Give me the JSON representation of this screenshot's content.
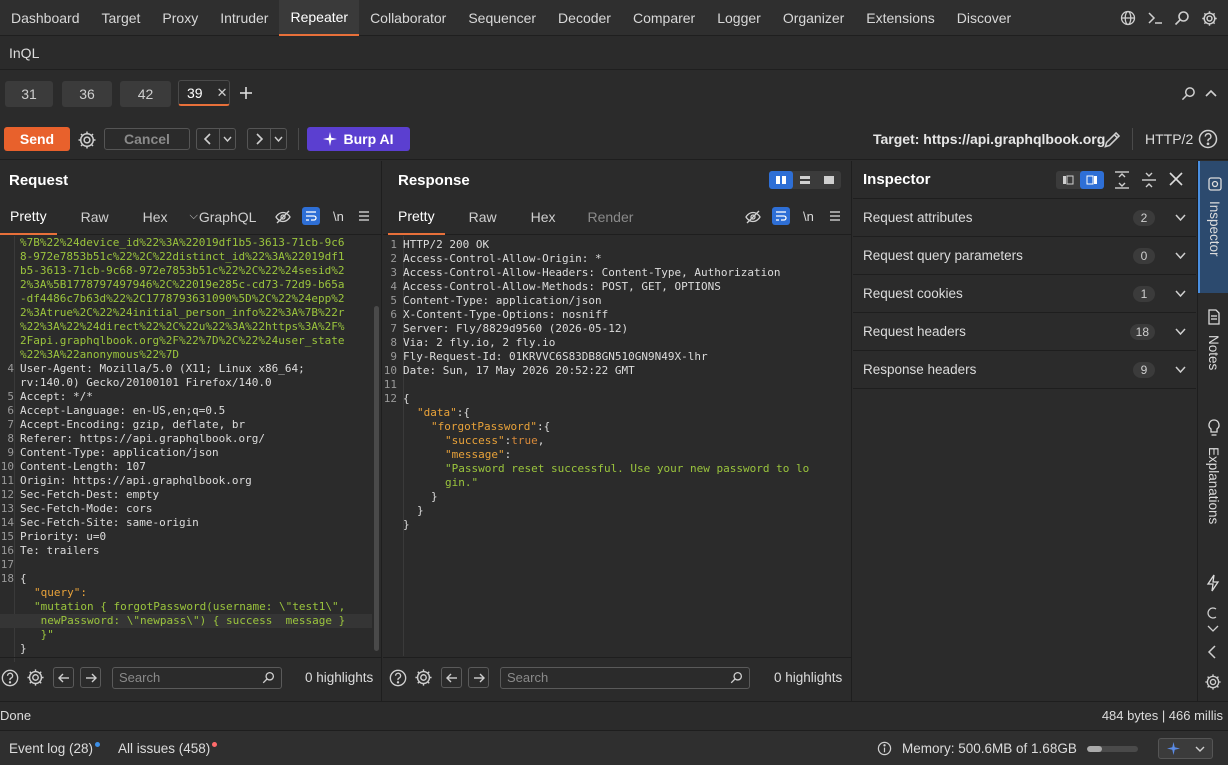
{
  "top_tabs": [
    "Dashboard",
    "Target",
    "Proxy",
    "Intruder",
    "Repeater",
    "Collaborator",
    "Sequencer",
    "Decoder",
    "Comparer",
    "Logger",
    "Organizer",
    "Extensions",
    "Discover"
  ],
  "active_top_tab": "Repeater",
  "sub_tab": "InQL",
  "repeater_tabs": [
    "31",
    "36",
    "42",
    "39"
  ],
  "active_repeater_tab": "39",
  "toolbar": {
    "send": "Send",
    "cancel": "Cancel",
    "burp_ai": "Burp AI",
    "target": "Target: https://api.graphqlbook.org",
    "http_version": "HTTP/2"
  },
  "request": {
    "title": "Request",
    "tabs": [
      "Pretty",
      "Raw",
      "Hex",
      "GraphQL"
    ],
    "active_tab": "Pretty",
    "newline_label": "\\n",
    "wrapped_cookie": [
      "%7B%22%24device_id%22%3A%22019df1b5-3613-71cb-9c6",
      "8-972e7853b51c%22%2C%22distinct_id%22%3A%22019df1",
      "b5-3613-71cb-9c68-972e7853b51c%22%2C%22%24sesid%2",
      "2%3A%5B1778797497946%2C%22019e285c-cd73-72d9-b65a",
      "-df4486c7b63d%22%2C1778793631090%5D%2C%22%24epp%2",
      "2%3Atrue%2C%22%24initial_person_info%22%3A%7B%22r",
      "%22%3A%22%24direct%22%2C%22u%22%3A%22https%3A%2F%",
      "2Fapi.graphqlbook.org%2F%22%7D%2C%22%24user_state",
      "%22%3A%22anonymous%22%7D"
    ],
    "headers": [
      {
        "n": "4",
        "t": "User-Agent: Mozilla/5.0 (X11; Linux x86_64;"
      },
      {
        "n": "",
        "t": "rv:140.0) Gecko/20100101 Firefox/140.0"
      },
      {
        "n": "5",
        "t": "Accept: */*"
      },
      {
        "n": "6",
        "t": "Accept-Language: en-US,en;q=0.5"
      },
      {
        "n": "7",
        "t": "Accept-Encoding: gzip, deflate, br"
      },
      {
        "n": "8",
        "t": "Referer: https://api.graphqlbook.org/"
      },
      {
        "n": "9",
        "t": "Content-Type: application/json"
      },
      {
        "n": "10",
        "t": "Content-Length: 107"
      },
      {
        "n": "11",
        "t": "Origin: https://api.graphqlbook.org"
      },
      {
        "n": "12",
        "t": "Sec-Fetch-Dest: empty"
      },
      {
        "n": "13",
        "t": "Sec-Fetch-Mode: cors"
      },
      {
        "n": "14",
        "t": "Sec-Fetch-Site: same-origin"
      },
      {
        "n": "15",
        "t": "Priority: u=0"
      },
      {
        "n": "16",
        "t": "Te: trailers"
      },
      {
        "n": "17",
        "t": ""
      }
    ],
    "body_open": "{",
    "body_key": "\"query\":",
    "body_val_1": "\"mutation { forgotPassword(username: \\\"test1\\\",",
    "body_val_2": " newPassword: \\\"newpass\\\") { success  message }",
    "body_val_3": " }\"",
    "body_close": "}",
    "search_placeholder": "Search",
    "highlights": "0 highlights"
  },
  "response": {
    "title": "Response",
    "tabs": [
      "Pretty",
      "Raw",
      "Hex",
      "Render"
    ],
    "active_tab": "Pretty",
    "newline_label": "\\n",
    "lines": [
      {
        "n": "1",
        "t": "HTTP/2 200 OK"
      },
      {
        "n": "2",
        "t": "Access-Control-Allow-Origin: *"
      },
      {
        "n": "3",
        "t": "Access-Control-Allow-Headers: Content-Type, Authorization"
      },
      {
        "n": "4",
        "t": "Access-Control-Allow-Methods: POST, GET, OPTIONS"
      },
      {
        "n": "5",
        "t": "Content-Type: application/json"
      },
      {
        "n": "6",
        "t": "X-Content-Type-Options: nosniff"
      },
      {
        "n": "7",
        "t": "Server: Fly/8829d9560 (2026-05-12)"
      },
      {
        "n": "8",
        "t": "Via: 2 fly.io, 2 fly.io"
      },
      {
        "n": "9",
        "t": "Fly-Request-Id: 01KRVVC6S83DB8GN510GN9N49X-lhr"
      },
      {
        "n": "10",
        "t": "Date: Sun, 17 May 2026 20:52:22 GMT"
      },
      {
        "n": "11",
        "t": ""
      },
      {
        "n": "12",
        "t": "{"
      }
    ],
    "json_data": "\"data\"",
    "json_fp": "\"forgotPassword\"",
    "json_success": "\"success\"",
    "json_true": "true",
    "json_message": "\"message\"",
    "json_msg_val_1": "\"Password reset successful. Use your new password to lo",
    "json_msg_val_2": "gin.\"",
    "search_placeholder": "Search",
    "highlights": "0 highlights"
  },
  "inspector": {
    "title": "Inspector",
    "rows": [
      {
        "label": "Request attributes",
        "count": "2"
      },
      {
        "label": "Request query parameters",
        "count": "0"
      },
      {
        "label": "Request cookies",
        "count": "1"
      },
      {
        "label": "Request headers",
        "count": "18"
      },
      {
        "label": "Response headers",
        "count": "9"
      }
    ]
  },
  "sidebar": {
    "inspector": "Inspector",
    "notes": "Notes",
    "explanations": "Explanations"
  },
  "status": {
    "left": "Done",
    "right": "484 bytes | 466 millis"
  },
  "bottom": {
    "event_log": "Event log (28)",
    "all_issues": "All issues (458)",
    "memory": "Memory: 500.6MB of 1.68GB",
    "memory_fraction": 0.3
  },
  "colors": {
    "accent": "#e8703a",
    "burp_ai": "#5b3fd0",
    "send": "#e8612c",
    "event_dot": "#3d8fe6",
    "issues_dot": "#ff6b6b"
  }
}
